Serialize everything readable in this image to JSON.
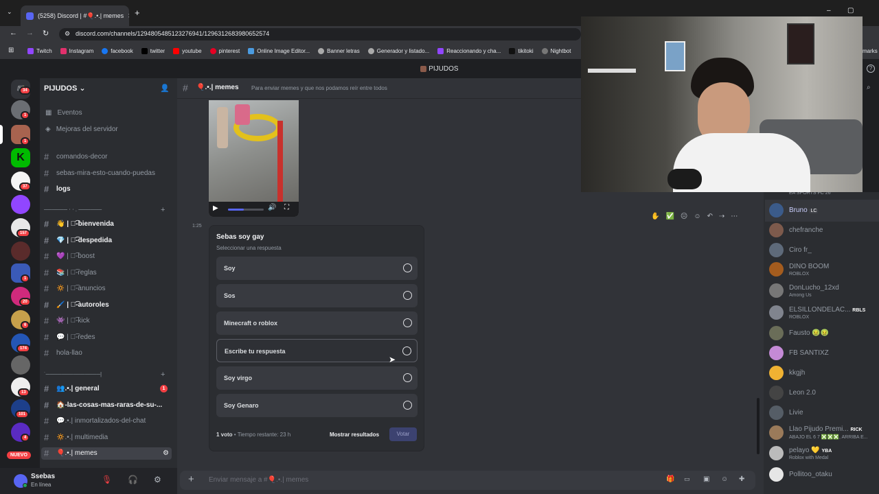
{
  "browser": {
    "tab_title": "(5258) Discord | #🎈.•.| memes",
    "url": "discord.com/channels/1294805485123276941/1296312683980652574",
    "bookmarks": [
      "Twitch",
      "Instagram",
      "facebook",
      "twitter",
      "youtube",
      "pinterest",
      "Online Image Editor...",
      "Banner letras",
      "Generador y listado...",
      "Reaccionando y cha...",
      "tikitoki",
      "Nightbot"
    ],
    "bookmarks_suffix": "marks"
  },
  "titlebar": {
    "server": "PIJUDOS"
  },
  "servers": {
    "badges": [
      "34",
      "1",
      "1",
      "37",
      "157",
      "1",
      "20",
      "6",
      "174",
      "13",
      "101",
      "4"
    ],
    "new_label": "NUEVO"
  },
  "sidebar": {
    "guild_name": "PIJUDOS",
    "events": "Eventos",
    "boost": "Mejoras del servidor",
    "channels_top": [
      "comandos-decor",
      "sebas-mira-esto-cuando-puedas",
      "logs"
    ],
    "category1": "────── ⋅ ⋅ . ──────",
    "channels_mid": [
      "👋 | ꒰͡-bienvenida",
      "💎 | ꒰͡-despedida",
      "💜 | ꒰͡-boost",
      "📚 | ꒰͡-reglas",
      "🔅 | ꒰͡-anuncios",
      "🖌️ | ꒰͡-autoroles",
      "👾 | ꒰͡-kick",
      "💬 | ꒰͡-redes",
      "hola-llao"
    ],
    "category2": "˙──────────────|",
    "channels_bottom": [
      "👥.•.| general",
      "🏠-las-cosas-mas-raras-de-su-...",
      "💬.•.| inmortalizados-del-chat",
      "🔅.•.| multimedia",
      "🎈.•.| memes"
    ],
    "general_badge": "1"
  },
  "user": {
    "name": "Ssebas",
    "status": "En línea"
  },
  "channel": {
    "name": "🎈.•.| memes",
    "topic": "Para enviar memes y que nos podamos reír entre todos"
  },
  "message": {
    "time": "1:25"
  },
  "poll": {
    "question": "Sebas soy gay",
    "hint": "Seleccionar una respuesta",
    "options": [
      "Soy",
      "Sos",
      "Minecraft o roblox",
      "Escribe tu respuesta",
      "Soy virgo",
      "Soy Genaro"
    ],
    "votes": "1 voto",
    "remaining": "Tiempo restante: 23 h",
    "show_results": "Mostrar resultados",
    "vote": "Votar"
  },
  "composer": {
    "placeholder": "Enviar mensaje a #🎈.•.| memes"
  },
  "members": [
    {
      "name": "EA SPORTS FC 26",
      "sub": ""
    },
    {
      "name": "Bruno",
      "sub": "",
      "tag": "LC"
    },
    {
      "name": "chefranche",
      "sub": ""
    },
    {
      "name": "Ciro fr_",
      "sub": ""
    },
    {
      "name": "DINO BOOM",
      "sub": "ROBLOX"
    },
    {
      "name": "DonLucho_12xd",
      "sub": "Among Us"
    },
    {
      "name": "ELSILLONDELAC...",
      "sub": "ROBLOX",
      "tag": "RBLS"
    },
    {
      "name": "Fausto 🤢🤢",
      "sub": ""
    },
    {
      "name": "FB SANTIXZ",
      "sub": ""
    },
    {
      "name": "kkgjh",
      "sub": ""
    },
    {
      "name": "Leon 2.0",
      "sub": ""
    },
    {
      "name": "Livie",
      "sub": ""
    },
    {
      "name": "Llao Pijudo Premi...",
      "sub": "ABAJO EL 6 7 ❎❎❎, ARRIBA E...",
      "tag": "RICK"
    },
    {
      "name": "pelayo 💛",
      "sub": "Roblox with Medal",
      "tag": "YBA"
    },
    {
      "name": "Pollitoo_otaku",
      "sub": ""
    }
  ],
  "colors": {
    "blurple": "#5865f2",
    "bg": "#313338",
    "sidebar": "#2b2d31",
    "red": "#f23f43",
    "green": "#23a55a"
  }
}
